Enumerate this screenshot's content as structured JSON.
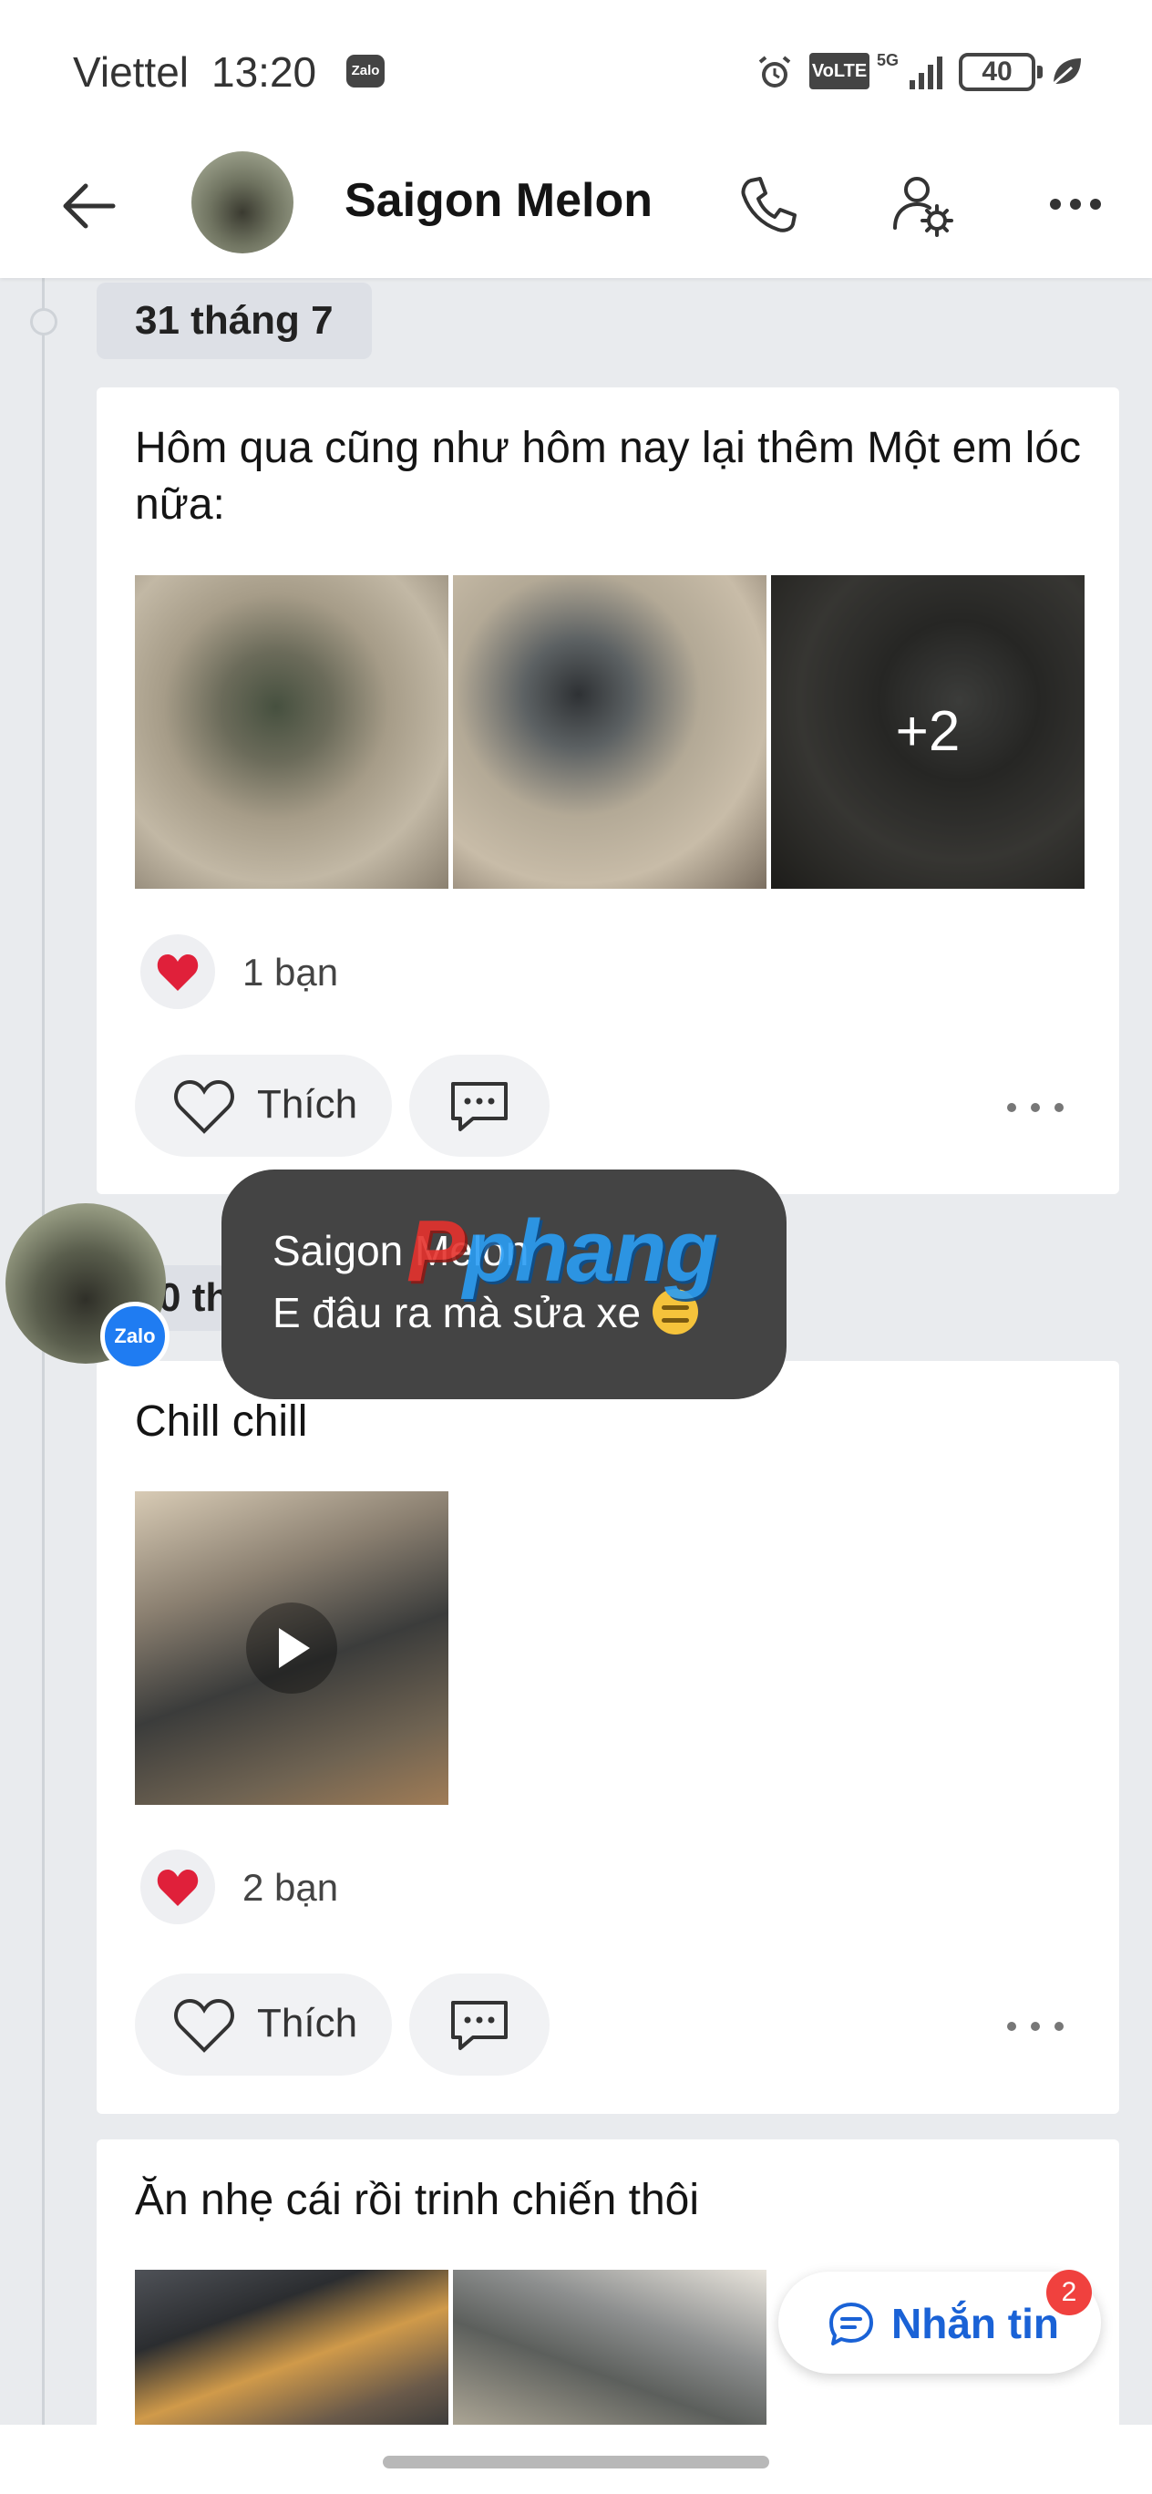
{
  "status_bar": {
    "carrier": "Viettel",
    "time": "13:20",
    "app_badge": "Zalo",
    "volte": "VoLTE",
    "network": "5G",
    "battery": "40"
  },
  "header": {
    "title": "Saigon Melon",
    "icons": [
      "back-arrow-icon",
      "phone-icon",
      "user-settings-icon",
      "more-icon"
    ]
  },
  "timeline": {
    "date_1": "31 tháng 7",
    "date_2_partial": "0 th"
  },
  "posts": [
    {
      "text": "Hôm qua cũng như hôm nay lại thêm Một em lóc nữa:",
      "extra_photos": "+2",
      "reaction_count": "1 bạn",
      "like_label": "Thích"
    },
    {
      "text": "Chill chill",
      "reaction_count": "2 bạn",
      "like_label": "Thích"
    },
    {
      "text": "Ăn nhẹ cái rồi trinh chiến thôi"
    }
  ],
  "notification": {
    "sender": "Saigon Melon",
    "message": "E đâu ra mà sửa xe",
    "app_badge": "Zalo"
  },
  "watermark": {
    "part1": "P",
    "part2": "phang"
  },
  "floating_button": {
    "label": "Nhắn tin",
    "badge": "2"
  },
  "colors": {
    "accent_blue": "#1a62d6",
    "heart_red": "#e0203a",
    "badge_red": "#f0413e",
    "toast_bg": "#444444"
  }
}
